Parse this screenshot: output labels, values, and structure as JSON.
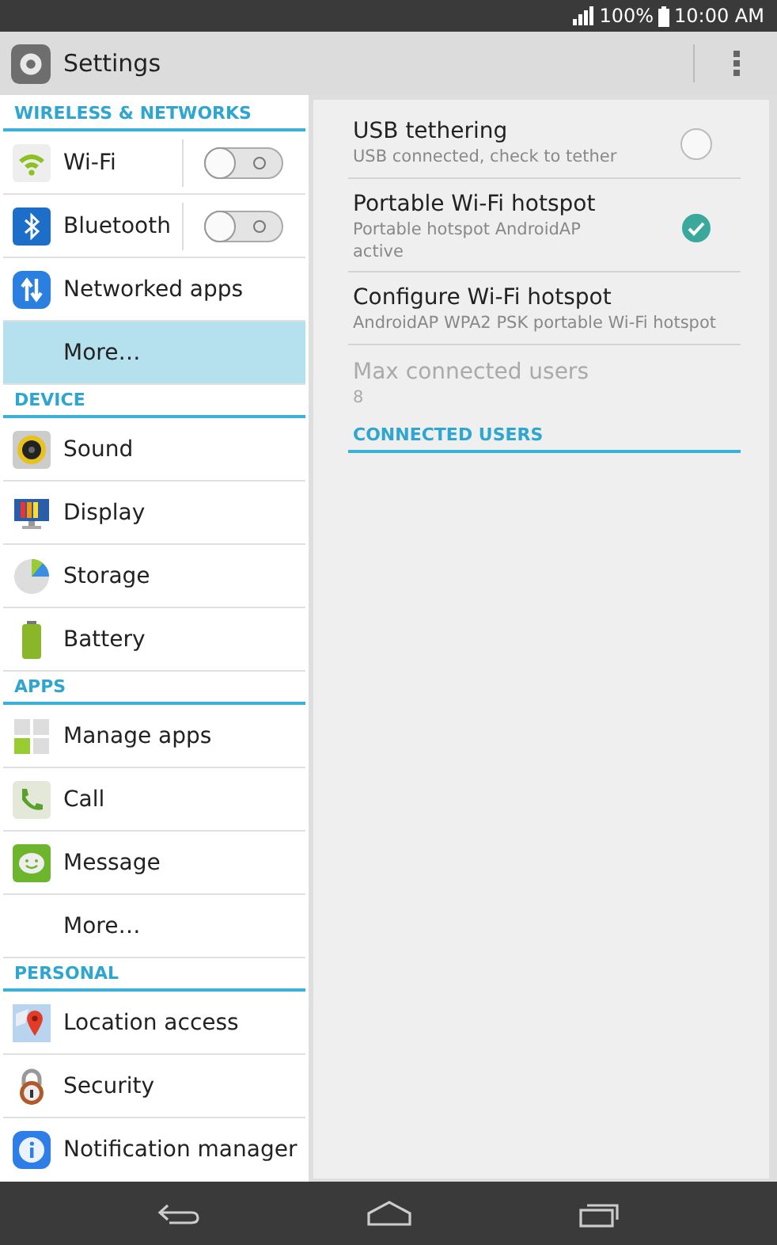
{
  "status_bar": {
    "battery": "100%",
    "time": "10:00 AM"
  },
  "action_bar": {
    "title": "Settings"
  },
  "sidebar": {
    "sections": [
      {
        "title": "WIRELESS & NETWORKS",
        "items": [
          {
            "label": "Wi-Fi",
            "selected": false,
            "toggle": {
              "on": false
            }
          },
          {
            "label": "Bluetooth",
            "selected": false,
            "toggle": {
              "on": false
            }
          },
          {
            "label": "Networked apps",
            "selected": false
          },
          {
            "label": "More…",
            "selected": true
          }
        ]
      },
      {
        "title": "DEVICE",
        "items": [
          {
            "label": "Sound",
            "selected": false
          },
          {
            "label": "Display",
            "selected": false
          },
          {
            "label": "Storage",
            "selected": false
          },
          {
            "label": "Battery",
            "selected": false
          }
        ]
      },
      {
        "title": "APPS",
        "items": [
          {
            "label": "Manage apps",
            "selected": false
          },
          {
            "label": "Call",
            "selected": false
          },
          {
            "label": "Message",
            "selected": false
          },
          {
            "label": "More…",
            "selected": false
          }
        ]
      },
      {
        "title": "PERSONAL",
        "items": [
          {
            "label": "Location access",
            "selected": false
          },
          {
            "label": "Security",
            "selected": false
          },
          {
            "label": "Notification manager",
            "selected": false
          }
        ]
      }
    ]
  },
  "detail": {
    "rows": [
      {
        "kind": "checkbox",
        "title": "USB tethering",
        "summary": "USB connected, check to tether",
        "checked": false,
        "disabled": false
      },
      {
        "kind": "checkbox",
        "title": "Portable Wi-Fi hotspot",
        "summary": "Portable hotspot AndroidAP active",
        "checked": true,
        "disabled": false
      },
      {
        "kind": "plain",
        "title": "Configure Wi-Fi hotspot",
        "summary": "AndroidAP WPA2 PSK portable Wi-Fi hotspot",
        "disabled": false
      },
      {
        "kind": "plain",
        "title": "Max connected users",
        "summary": "8",
        "disabled": true
      }
    ],
    "section_title": "CONNECTED USERS"
  }
}
